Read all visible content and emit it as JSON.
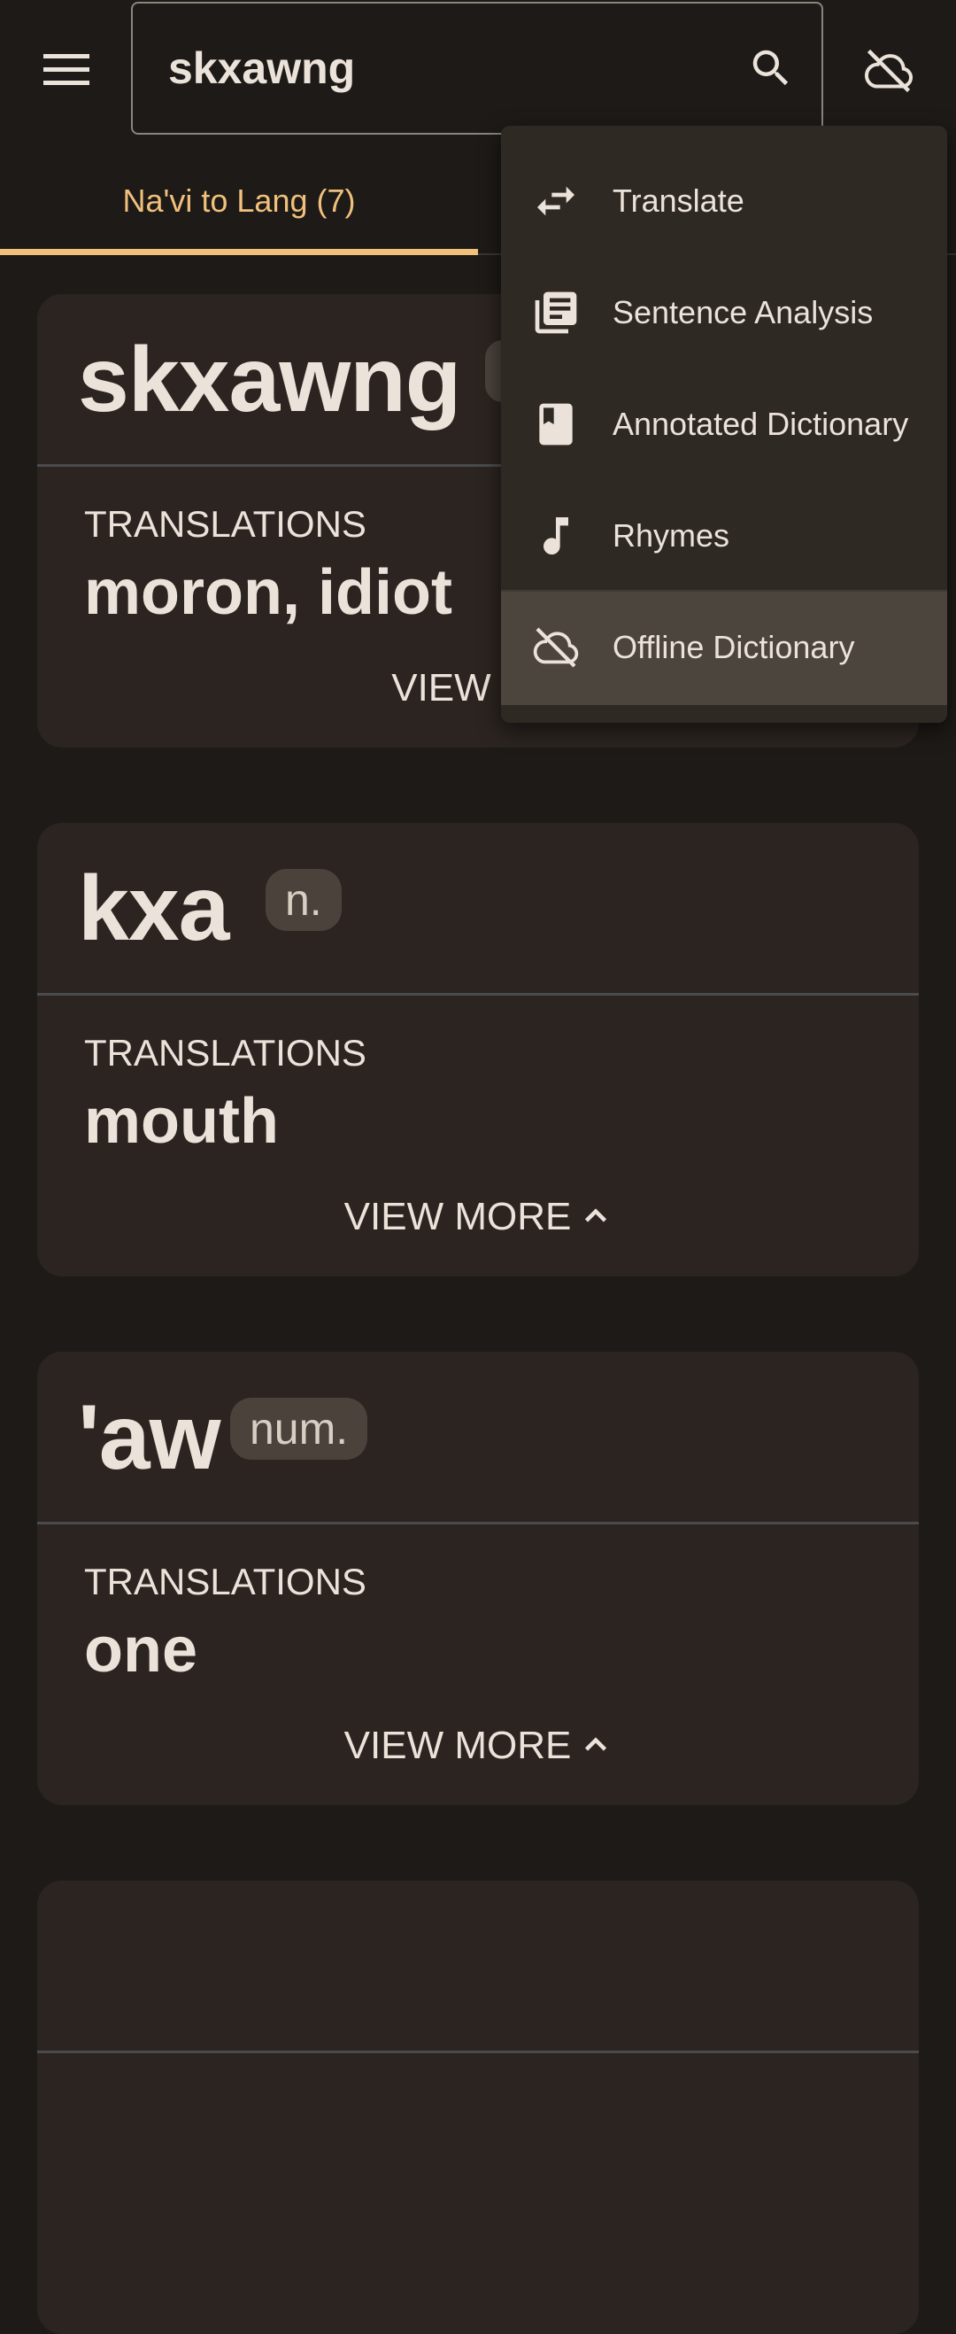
{
  "search": {
    "query": "skxawng"
  },
  "tabs": [
    {
      "label": "Na'vi to Lang (7)",
      "active": true
    }
  ],
  "menu": {
    "items": [
      {
        "label": "Translate",
        "icon": "swap-arrows-icon"
      },
      {
        "label": "Sentence Analysis",
        "icon": "article-icon"
      },
      {
        "label": "Annotated Dictionary",
        "icon": "book-icon"
      },
      {
        "label": "Rhymes",
        "icon": "music-note-icon"
      },
      {
        "label": "Offline Dictionary",
        "icon": "cloud-off-icon",
        "selected": true
      }
    ]
  },
  "results": [
    {
      "word": "skxawng",
      "pos": "",
      "translations_label": "TRANSLATIONS",
      "translation": "moron, idiot",
      "view_more": "VIEW MO"
    },
    {
      "word": "kxa",
      "pos": "n.",
      "translations_label": "TRANSLATIONS",
      "translation": "mouth",
      "view_more": "VIEW MORE"
    },
    {
      "word": "'aw",
      "pos": "num.",
      "translations_label": "TRANSLATIONS",
      "translation": "one",
      "view_more": "VIEW MORE"
    },
    {
      "word": "",
      "pos": ""
    }
  ],
  "colors": {
    "background": "#1d1a17",
    "card": "#2b2420",
    "accent": "#f0c07c",
    "text": "#ebe2da",
    "menu": "#2f2923",
    "menu_selected": "#4b453e"
  }
}
